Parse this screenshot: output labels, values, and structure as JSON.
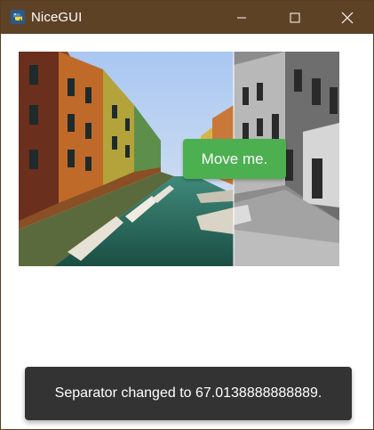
{
  "window": {
    "title": "NiceGUI",
    "titlebar_color": "#5e4226",
    "icons": {
      "app": "python-icon",
      "minimize": "minimize-icon",
      "maximize": "maximize-icon",
      "close": "close-icon"
    }
  },
  "image_compare": {
    "separator_position_percent": 67.0138888888889,
    "left_image": "color canal photo",
    "right_image": "grayscale canal photo"
  },
  "move_button": {
    "label": "Move me.",
    "color": "#4caf50"
  },
  "notification": {
    "text": "Separator changed to 67.0138888888889."
  }
}
